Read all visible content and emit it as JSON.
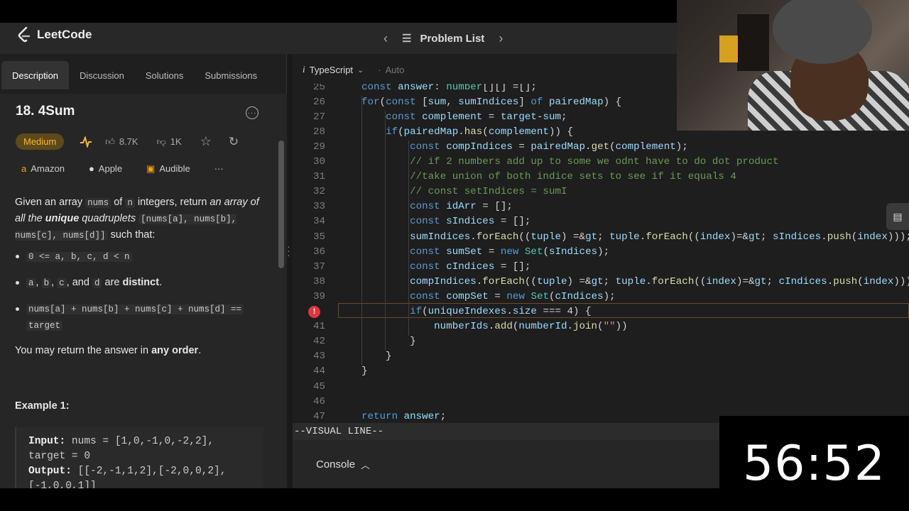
{
  "site": {
    "name": "LeetCode"
  },
  "nav": {
    "problem_list": "Problem List",
    "prev_icon": "chevron-left-icon",
    "next_icon": "chevron-right-icon"
  },
  "tabs": [
    "Description",
    "Discussion",
    "Solutions",
    "Submissions"
  ],
  "problem": {
    "title": "18. 4Sum",
    "difficulty": "Medium",
    "likes": "8.7K",
    "dislikes": "1K",
    "companies": [
      "Amazon",
      "Apple",
      "Audible"
    ],
    "more_companies": "···",
    "desc_1": "Given an array",
    "desc_nums": "nums",
    "desc_2": "of",
    "desc_n": "n",
    "desc_3": "integers, return",
    "desc_em1": "an array of all the",
    "desc_strong": "unique",
    "desc_em2": "quadruplets",
    "desc_code": "[nums[a], nums[b], nums[c], nums[d]]",
    "desc_4": "such that:",
    "b1_code": "0 <= a, b, c, d < n",
    "b2_a": "a",
    "b2_b": "b",
    "b2_c": "c",
    "b2_and": ", and",
    "b2_d": "d",
    "b2_are": "are",
    "b2_strong": "distinct",
    "b3_code": "nums[a] + nums[b] + nums[c] + nums[d] ==",
    "b3_code2": "target",
    "may_1": "You may return the answer in",
    "may_strong": "any order",
    "example_title": "Example 1:",
    "ex_input_label": "Input:",
    "ex_input": "nums = [1,0,-1,0,-2,2],",
    "ex_input2": "target = 0",
    "ex_output_label": "Output:",
    "ex_output": "[[-2,-1,1,2],[-2,0,0,2],",
    "ex_output2": "[-1,0,0,1]]"
  },
  "editor": {
    "language": "TypeScript",
    "mode": "Auto",
    "status_line": "--VISUAL LINE--",
    "console_label": "Console"
  },
  "code_lines": [
    {
      "n": "25",
      "text": "const answer: number[][] =[];"
    },
    {
      "n": "26",
      "text": "for(const [sum, sumIndices] of pairedMap) {"
    },
    {
      "n": "27",
      "text": "    const complement = target-sum;"
    },
    {
      "n": "28",
      "text": "    if(pairedMap.has(complement)) {"
    },
    {
      "n": "29",
      "text": "        const compIndices = pairedMap.get(complement);"
    },
    {
      "n": "30",
      "text": "        // if 2 numbers add up to some we odnt have to do dot product"
    },
    {
      "n": "31",
      "text": "        //take union of both indice sets to see if it equals 4"
    },
    {
      "n": "32",
      "text": "        // const setIndices = sumI"
    },
    {
      "n": "33",
      "text": "        const idArr = [];"
    },
    {
      "n": "34",
      "text": "        const sIndices = [];"
    },
    {
      "n": "35",
      "text": "        sumIndices.forEach((tuple) => tuple.forEach((index)=> sIndices.push(index)));"
    },
    {
      "n": "36",
      "text": "        const sumSet = new Set(sIndices);"
    },
    {
      "n": "37",
      "text": "        const cIndices = [];"
    },
    {
      "n": "38",
      "text": "        compIndices.forEach((tuple) => tuple.forEach((index)=> cIndices.push(index)));"
    },
    {
      "n": "39",
      "text": "        const compSet = new Set(cIndices);"
    },
    {
      "n": "",
      "text": "        if(uniqueIndexes.size === 4) {"
    },
    {
      "n": "41",
      "text": "            numberIds.add(numberId.join(\"\"))"
    },
    {
      "n": "42",
      "text": "        }"
    },
    {
      "n": "43",
      "text": "    }"
    },
    {
      "n": "44",
      "text": "}"
    },
    {
      "n": "45",
      "text": ""
    },
    {
      "n": "46",
      "text": ""
    },
    {
      "n": "47",
      "text": "return answer;"
    }
  ],
  "timer": "56:52",
  "colors": {
    "medium": "#f6b83d",
    "error": "#e0363c",
    "accent": "#569cd6"
  }
}
